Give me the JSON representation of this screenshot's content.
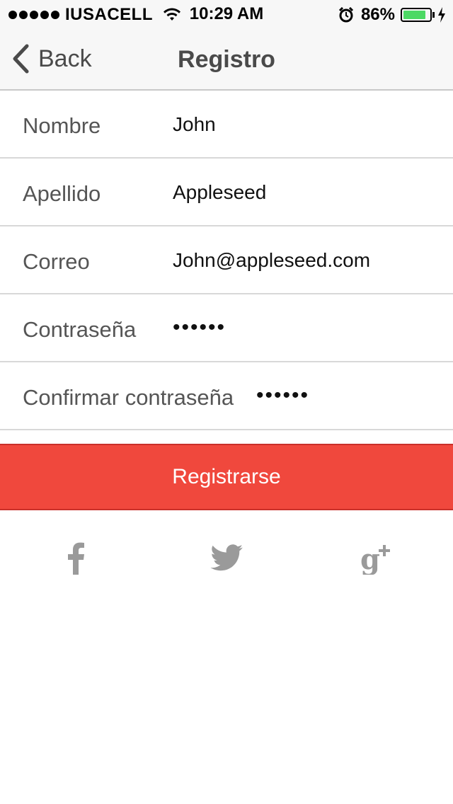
{
  "status_bar": {
    "carrier": "IUSACELL",
    "time": "10:29 AM",
    "battery_percent": "86%",
    "battery_level": 0.86,
    "signal_bars": 5
  },
  "nav": {
    "back_label": "Back",
    "title": "Registro"
  },
  "form": {
    "fields": [
      {
        "label": "Nombre",
        "value": "John"
      },
      {
        "label": "Apellido",
        "value": "Appleseed"
      },
      {
        "label": "Correo",
        "value": "John@appleseed.com"
      },
      {
        "label": "Contraseña",
        "value": "••••••"
      },
      {
        "label": "Confirmar contraseña",
        "value": "••••••"
      }
    ]
  },
  "register_button": {
    "label": "Registrarse",
    "color": "#f0483d"
  },
  "social": {
    "icons": [
      "facebook-icon",
      "twitter-icon",
      "google-plus-icon"
    ],
    "icon_color": "#9a9a9a"
  }
}
